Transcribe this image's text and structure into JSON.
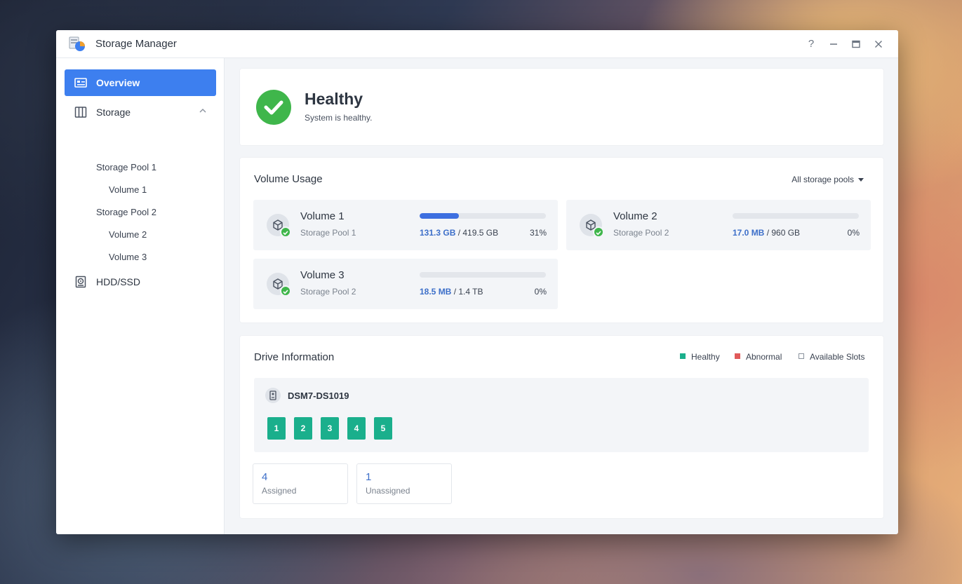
{
  "window": {
    "title": "Storage Manager",
    "controls": {
      "help": "?",
      "minimize": "—",
      "maximize": "□",
      "close": "✕"
    }
  },
  "sidebar": {
    "overview": {
      "label": "Overview",
      "icon": "overview-icon"
    },
    "storage": {
      "label": "Storage",
      "icon": "storage-icon",
      "expanded": true
    },
    "pools": [
      {
        "label": "Storage Pool 1",
        "volumes": [
          "Volume 1"
        ]
      },
      {
        "label": "Storage Pool 2",
        "volumes": [
          "Volume 2",
          "Volume 3"
        ]
      }
    ],
    "hdd": {
      "label": "HDD/SSD",
      "icon": "hdd-icon"
    }
  },
  "status": {
    "title": "Healthy",
    "subtitle": "System is healthy.",
    "color": "#3fb64b"
  },
  "volume_usage": {
    "title": "Volume Usage",
    "filter": "All storage pools",
    "volumes": [
      {
        "name": "Volume 1",
        "pool": "Storage Pool 1",
        "used": "131.3 GB",
        "total": "/ 419.5 GB",
        "percent_label": "31%",
        "percent": 31
      },
      {
        "name": "Volume 2",
        "pool": "Storage Pool 2",
        "used": "17.0 MB",
        "total": "/ 960 GB",
        "percent_label": "0%",
        "percent": 0
      },
      {
        "name": "Volume 3",
        "pool": "Storage Pool 2",
        "used": "18.5 MB",
        "total": "/ 1.4 TB",
        "percent_label": "0%",
        "percent": 0
      }
    ]
  },
  "drive_info": {
    "title": "Drive Information",
    "legend": {
      "healthy": "Healthy",
      "abnormal": "Abnormal",
      "available": "Available Slots",
      "healthy_color": "#1aaf8c",
      "abnormal_color": "#e05a5a"
    },
    "server": "DSM7-DS1019",
    "slots": [
      "1",
      "2",
      "3",
      "4",
      "5"
    ],
    "stats": [
      {
        "value": "4",
        "label": "Assigned"
      },
      {
        "value": "1",
        "label": "Unassigned"
      }
    ]
  },
  "colors": {
    "accent": "#3d7fef",
    "healthy": "#3fb64b",
    "drive_ok": "#1aaf8c",
    "bar_fill": "#3d6fe0"
  }
}
